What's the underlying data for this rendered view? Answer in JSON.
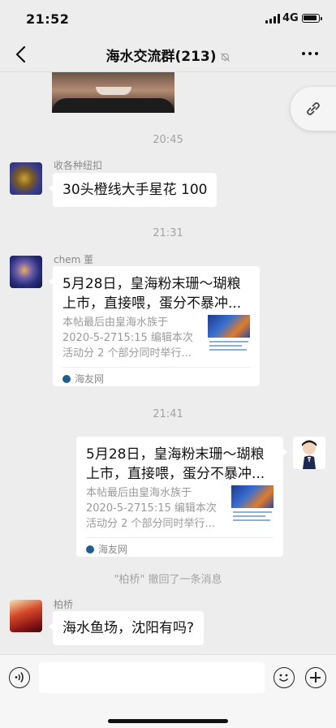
{
  "status_bar": {
    "time": "21:52",
    "network": "4G"
  },
  "nav": {
    "title": "海水交流群(213)"
  },
  "messages": {
    "time_1": "20:45",
    "msg1": {
      "sender": "收各种纽扣",
      "text": "30头橙线大手星花  100"
    },
    "time_2": "21:31",
    "msg2": {
      "sender": "chem 董",
      "link_title": "5月28日，皇海粉末珊～瑚粮上市，直接喂，蛋分不暴冲...",
      "link_desc": "本帖最后由皇海水族于 2020-5-2715:15 编辑本次活动分 2 个部分同时举行...",
      "source": "海友网"
    },
    "time_3": "21:41",
    "msg3": {
      "link_title": "5月28日，皇海粉末珊～瑚粮上市，直接喂，蛋分不暴冲...",
      "link_desc": "本帖最后由皇海水族于 2020-5-2715:15 编辑本次活动分 2 个部分同时举行...",
      "source": "海友网"
    },
    "recall_notice": "\"柏桥\" 撤回了一条消息",
    "msg4": {
      "sender": "柏桥",
      "text": "海水鱼场，沈阳有吗?"
    }
  },
  "input": {
    "value": ""
  },
  "icons": {
    "back": "back-arrow-icon",
    "mute": "mute-bell-icon",
    "more": "more-dots-icon",
    "link": "link-icon",
    "voice": "voice-icon",
    "emoji": "emoji-icon",
    "plus": "plus-icon"
  },
  "colors": {
    "background": "#ededed",
    "bubble": "#ffffff",
    "muted_text": "#a3a3a3"
  }
}
